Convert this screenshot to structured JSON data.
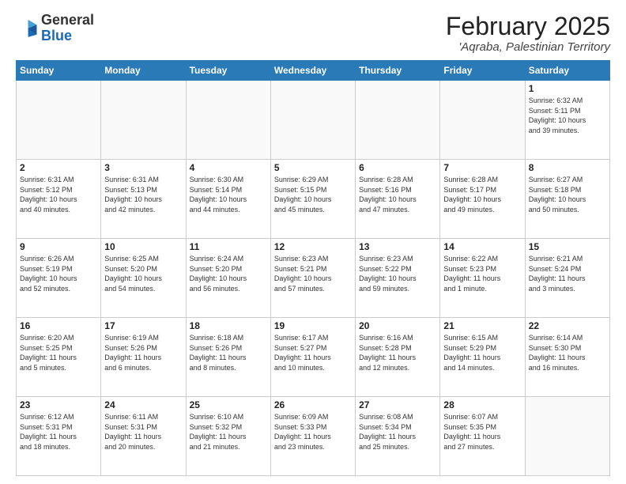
{
  "header": {
    "logo_general": "General",
    "logo_blue": "Blue",
    "month": "February 2025",
    "location": "'Aqraba, Palestinian Territory"
  },
  "days_of_week": [
    "Sunday",
    "Monday",
    "Tuesday",
    "Wednesday",
    "Thursday",
    "Friday",
    "Saturday"
  ],
  "weeks": [
    [
      {
        "day": "",
        "info": ""
      },
      {
        "day": "",
        "info": ""
      },
      {
        "day": "",
        "info": ""
      },
      {
        "day": "",
        "info": ""
      },
      {
        "day": "",
        "info": ""
      },
      {
        "day": "",
        "info": ""
      },
      {
        "day": "1",
        "info": "Sunrise: 6:32 AM\nSunset: 5:11 PM\nDaylight: 10 hours\nand 39 minutes."
      }
    ],
    [
      {
        "day": "2",
        "info": "Sunrise: 6:31 AM\nSunset: 5:12 PM\nDaylight: 10 hours\nand 40 minutes."
      },
      {
        "day": "3",
        "info": "Sunrise: 6:31 AM\nSunset: 5:13 PM\nDaylight: 10 hours\nand 42 minutes."
      },
      {
        "day": "4",
        "info": "Sunrise: 6:30 AM\nSunset: 5:14 PM\nDaylight: 10 hours\nand 44 minutes."
      },
      {
        "day": "5",
        "info": "Sunrise: 6:29 AM\nSunset: 5:15 PM\nDaylight: 10 hours\nand 45 minutes."
      },
      {
        "day": "6",
        "info": "Sunrise: 6:28 AM\nSunset: 5:16 PM\nDaylight: 10 hours\nand 47 minutes."
      },
      {
        "day": "7",
        "info": "Sunrise: 6:28 AM\nSunset: 5:17 PM\nDaylight: 10 hours\nand 49 minutes."
      },
      {
        "day": "8",
        "info": "Sunrise: 6:27 AM\nSunset: 5:18 PM\nDaylight: 10 hours\nand 50 minutes."
      }
    ],
    [
      {
        "day": "9",
        "info": "Sunrise: 6:26 AM\nSunset: 5:19 PM\nDaylight: 10 hours\nand 52 minutes."
      },
      {
        "day": "10",
        "info": "Sunrise: 6:25 AM\nSunset: 5:20 PM\nDaylight: 10 hours\nand 54 minutes."
      },
      {
        "day": "11",
        "info": "Sunrise: 6:24 AM\nSunset: 5:20 PM\nDaylight: 10 hours\nand 56 minutes."
      },
      {
        "day": "12",
        "info": "Sunrise: 6:23 AM\nSunset: 5:21 PM\nDaylight: 10 hours\nand 57 minutes."
      },
      {
        "day": "13",
        "info": "Sunrise: 6:23 AM\nSunset: 5:22 PM\nDaylight: 10 hours\nand 59 minutes."
      },
      {
        "day": "14",
        "info": "Sunrise: 6:22 AM\nSunset: 5:23 PM\nDaylight: 11 hours\nand 1 minute."
      },
      {
        "day": "15",
        "info": "Sunrise: 6:21 AM\nSunset: 5:24 PM\nDaylight: 11 hours\nand 3 minutes."
      }
    ],
    [
      {
        "day": "16",
        "info": "Sunrise: 6:20 AM\nSunset: 5:25 PM\nDaylight: 11 hours\nand 5 minutes."
      },
      {
        "day": "17",
        "info": "Sunrise: 6:19 AM\nSunset: 5:26 PM\nDaylight: 11 hours\nand 6 minutes."
      },
      {
        "day": "18",
        "info": "Sunrise: 6:18 AM\nSunset: 5:26 PM\nDaylight: 11 hours\nand 8 minutes."
      },
      {
        "day": "19",
        "info": "Sunrise: 6:17 AM\nSunset: 5:27 PM\nDaylight: 11 hours\nand 10 minutes."
      },
      {
        "day": "20",
        "info": "Sunrise: 6:16 AM\nSunset: 5:28 PM\nDaylight: 11 hours\nand 12 minutes."
      },
      {
        "day": "21",
        "info": "Sunrise: 6:15 AM\nSunset: 5:29 PM\nDaylight: 11 hours\nand 14 minutes."
      },
      {
        "day": "22",
        "info": "Sunrise: 6:14 AM\nSunset: 5:30 PM\nDaylight: 11 hours\nand 16 minutes."
      }
    ],
    [
      {
        "day": "23",
        "info": "Sunrise: 6:12 AM\nSunset: 5:31 PM\nDaylight: 11 hours\nand 18 minutes."
      },
      {
        "day": "24",
        "info": "Sunrise: 6:11 AM\nSunset: 5:31 PM\nDaylight: 11 hours\nand 20 minutes."
      },
      {
        "day": "25",
        "info": "Sunrise: 6:10 AM\nSunset: 5:32 PM\nDaylight: 11 hours\nand 21 minutes."
      },
      {
        "day": "26",
        "info": "Sunrise: 6:09 AM\nSunset: 5:33 PM\nDaylight: 11 hours\nand 23 minutes."
      },
      {
        "day": "27",
        "info": "Sunrise: 6:08 AM\nSunset: 5:34 PM\nDaylight: 11 hours\nand 25 minutes."
      },
      {
        "day": "28",
        "info": "Sunrise: 6:07 AM\nSunset: 5:35 PM\nDaylight: 11 hours\nand 27 minutes."
      },
      {
        "day": "",
        "info": ""
      }
    ]
  ]
}
